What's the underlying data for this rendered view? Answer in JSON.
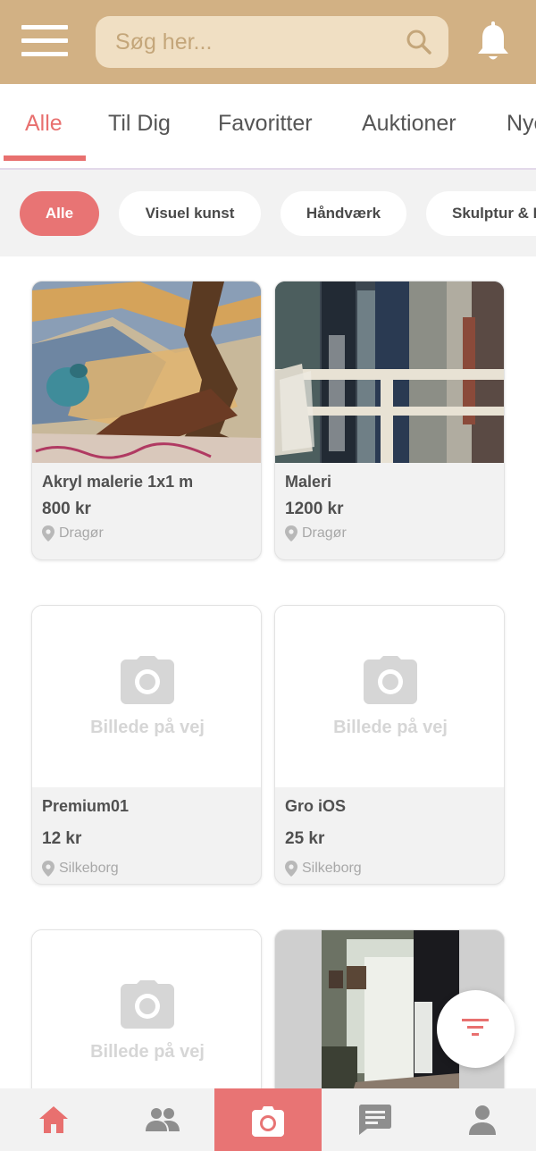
{
  "search": {
    "placeholder": "Søg her..."
  },
  "tabs": [
    {
      "label": "Alle",
      "active": true
    },
    {
      "label": "Til Dig",
      "active": false
    },
    {
      "label": "Favoritter",
      "active": false
    },
    {
      "label": "Auktioner",
      "active": false
    },
    {
      "label": "Nye",
      "active": false
    }
  ],
  "chips": [
    {
      "label": "Alle",
      "active": true
    },
    {
      "label": "Visuel kunst",
      "active": false
    },
    {
      "label": "Håndværk",
      "active": false
    },
    {
      "label": "Skulptur & Design",
      "active": false
    }
  ],
  "listings": [
    {
      "title": "Akryl malerie 1x1 m",
      "price": "800 kr",
      "location": "Dragør",
      "image": "painting-bird"
    },
    {
      "title": "Maleri",
      "price": "1200 kr",
      "location": "Dragør",
      "image": "painting-city"
    },
    {
      "title": "Premium01",
      "price": "12 kr",
      "location": "Silkeborg",
      "image": "placeholder"
    },
    {
      "title": "Gro iOS",
      "price": "25 kr",
      "location": "Silkeborg",
      "image": "placeholder"
    },
    {
      "title": "",
      "price": "",
      "location": "",
      "image": "placeholder"
    },
    {
      "title": "",
      "price": "",
      "location": "",
      "image": "photo-room"
    }
  ],
  "placeholder_text": "Billede på vej",
  "bottom_nav": [
    {
      "icon": "home-icon",
      "active": true
    },
    {
      "icon": "people-icon",
      "active": false
    },
    {
      "icon": "camera-icon",
      "active": false
    },
    {
      "icon": "chat-icon",
      "active": false
    },
    {
      "icon": "profile-icon",
      "active": false
    }
  ],
  "colors": {
    "header": "#d2b184",
    "accent": "#e8706f",
    "chip_active": "#e87474",
    "search_bg": "#f0dfc3"
  }
}
